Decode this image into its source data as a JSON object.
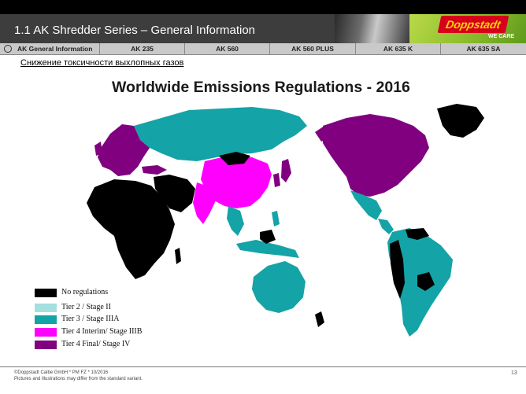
{
  "header": {
    "title": "1.1 AK Shredder Series – General Information",
    "logo_text": "Doppstadt",
    "slogan": "WE CARE"
  },
  "tabs": [
    {
      "label": "AK General Information"
    },
    {
      "label": "AK 235"
    },
    {
      "label": "AK 560"
    },
    {
      "label": "AK 560 PLUS"
    },
    {
      "label": "AK 635 K"
    },
    {
      "label": "AK 635 SA"
    }
  ],
  "subtitle": "Снижение токсичности выхлопных газов",
  "map": {
    "title": "Worldwide Emissions Regulations - 2016",
    "colors": {
      "none": "#000000",
      "tier2": "#a6dfe0",
      "tier3": "#14a3a6",
      "tier4_interim": "#ff00ff",
      "tier4_final": "#800080"
    }
  },
  "legend": [
    {
      "label": "No regulations",
      "color": "#000000"
    },
    {
      "label": "Tier 2 / Stage II",
      "color": "#a6dfe0"
    },
    {
      "label": "Tier 3 / Stage IIIA",
      "color": "#14a3a6"
    },
    {
      "label": "Tier 4 Interim/ Stage IIIB",
      "color": "#ff00ff"
    },
    {
      "label": "Tier 4 Final/ Stage IV",
      "color": "#800080"
    }
  ],
  "footer": {
    "line1": "©Doppstadt Calbe GmbH * PM FZ * 10/2016",
    "line2": "Pictures and illustrations may differ from the standard variant.",
    "page": "13"
  }
}
